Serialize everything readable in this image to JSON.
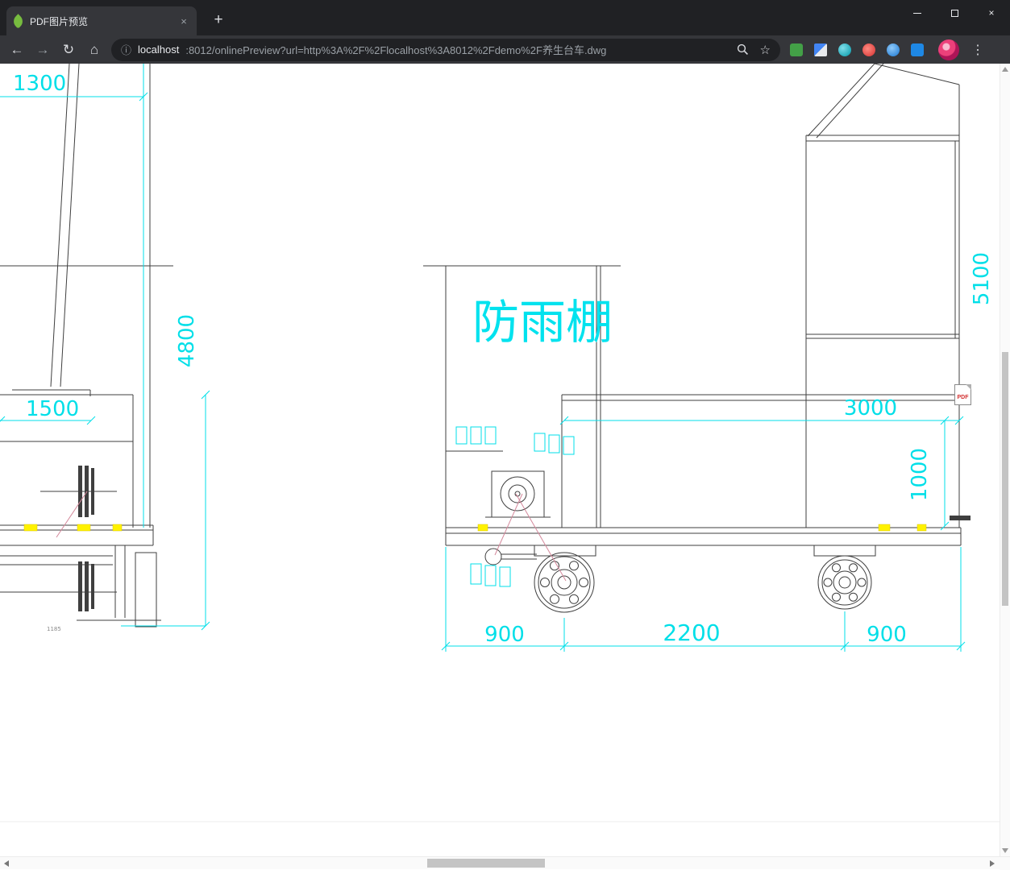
{
  "tab": {
    "title": "PDF图片预览"
  },
  "toolbar": {
    "omnibox": {
      "host": "localhost",
      "path": ":8012/onlinePreview?url=http%3A%2F%2Flocalhost%3A8012%2Fdemo%2F养生台车.dwg"
    }
  },
  "icons": {
    "back": "←",
    "forward": "→",
    "reload": "↻",
    "home": "⌂",
    "info": "ⓘ",
    "bookmark_star": "☆",
    "menu_dots": "⋮",
    "new_tab": "+",
    "tab_close": "×",
    "window_close": "×"
  },
  "drawing": {
    "labels": {
      "canopy": "防雨棚",
      "dim_1300": "1300",
      "dim_4800": "4800",
      "dim_1500": "1500",
      "dim_5100": "5100",
      "dim_3000": "3000",
      "dim_1000": "1000",
      "dim_900_left": "900",
      "dim_2200": "2200",
      "dim_900_right": "900",
      "dim_small": "1185"
    },
    "pdf_badge": "PDF",
    "colors": {
      "dimension_cyan": "#00dfe8",
      "line_black": "#3f3f3f",
      "highlight_yellow": "#fff200",
      "accent_red": "#d4889b"
    }
  }
}
